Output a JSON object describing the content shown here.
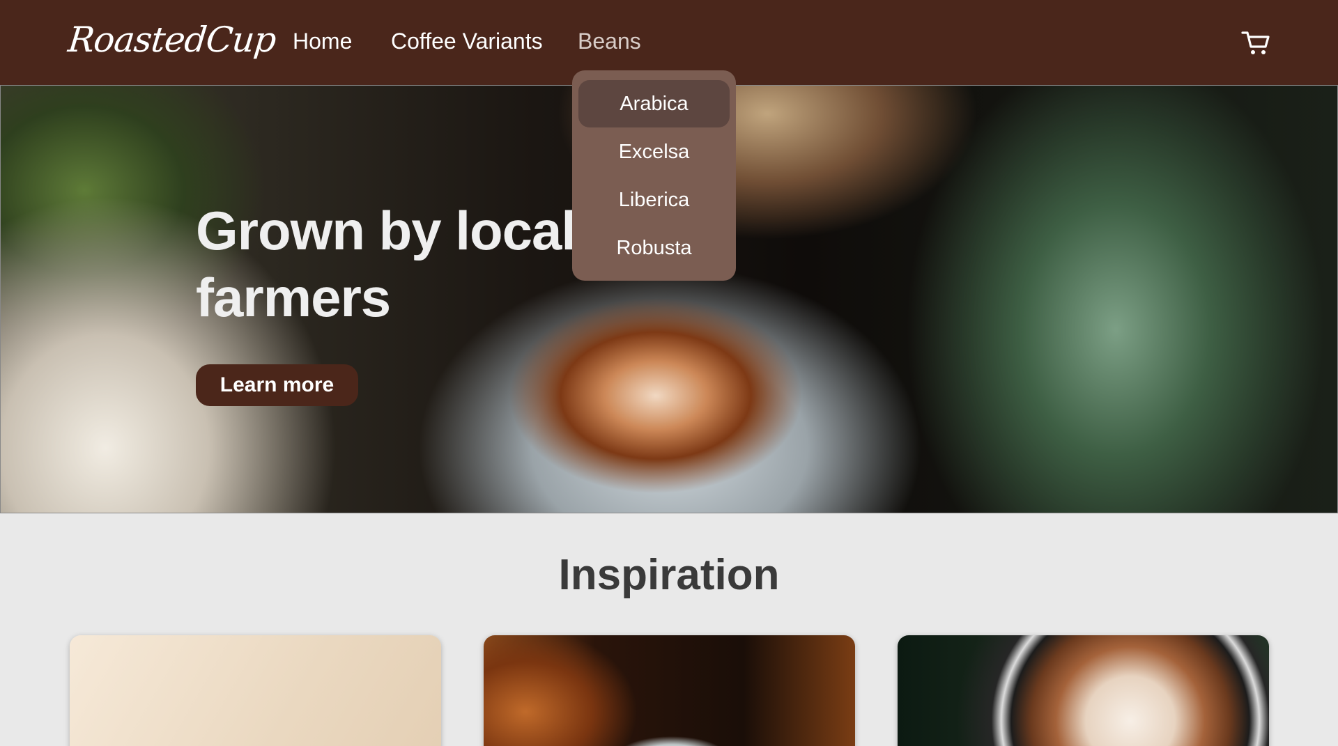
{
  "navbar": {
    "logo": "RoastedCup",
    "links": [
      {
        "label": "Home"
      },
      {
        "label": "Coffee Variants"
      },
      {
        "label": "Beans"
      }
    ],
    "cart_icon": "shopping-cart-icon"
  },
  "dropdown": {
    "items": [
      {
        "label": "Arabica",
        "active": true
      },
      {
        "label": "Excelsa"
      },
      {
        "label": "Liberica"
      },
      {
        "label": "Robusta"
      }
    ]
  },
  "hero": {
    "title": "Grown by local farmers",
    "button_label": "Learn more"
  },
  "inspiration": {
    "title": "Inspiration",
    "cards": [
      {
        "name": "card-1"
      },
      {
        "name": "card-2"
      },
      {
        "name": "card-3"
      }
    ]
  },
  "colors": {
    "brand": "#4a261b",
    "dropdown_bg": "#7b5d52",
    "dropdown_active": "#5d4640",
    "page_bg": "#e9e9e9"
  }
}
